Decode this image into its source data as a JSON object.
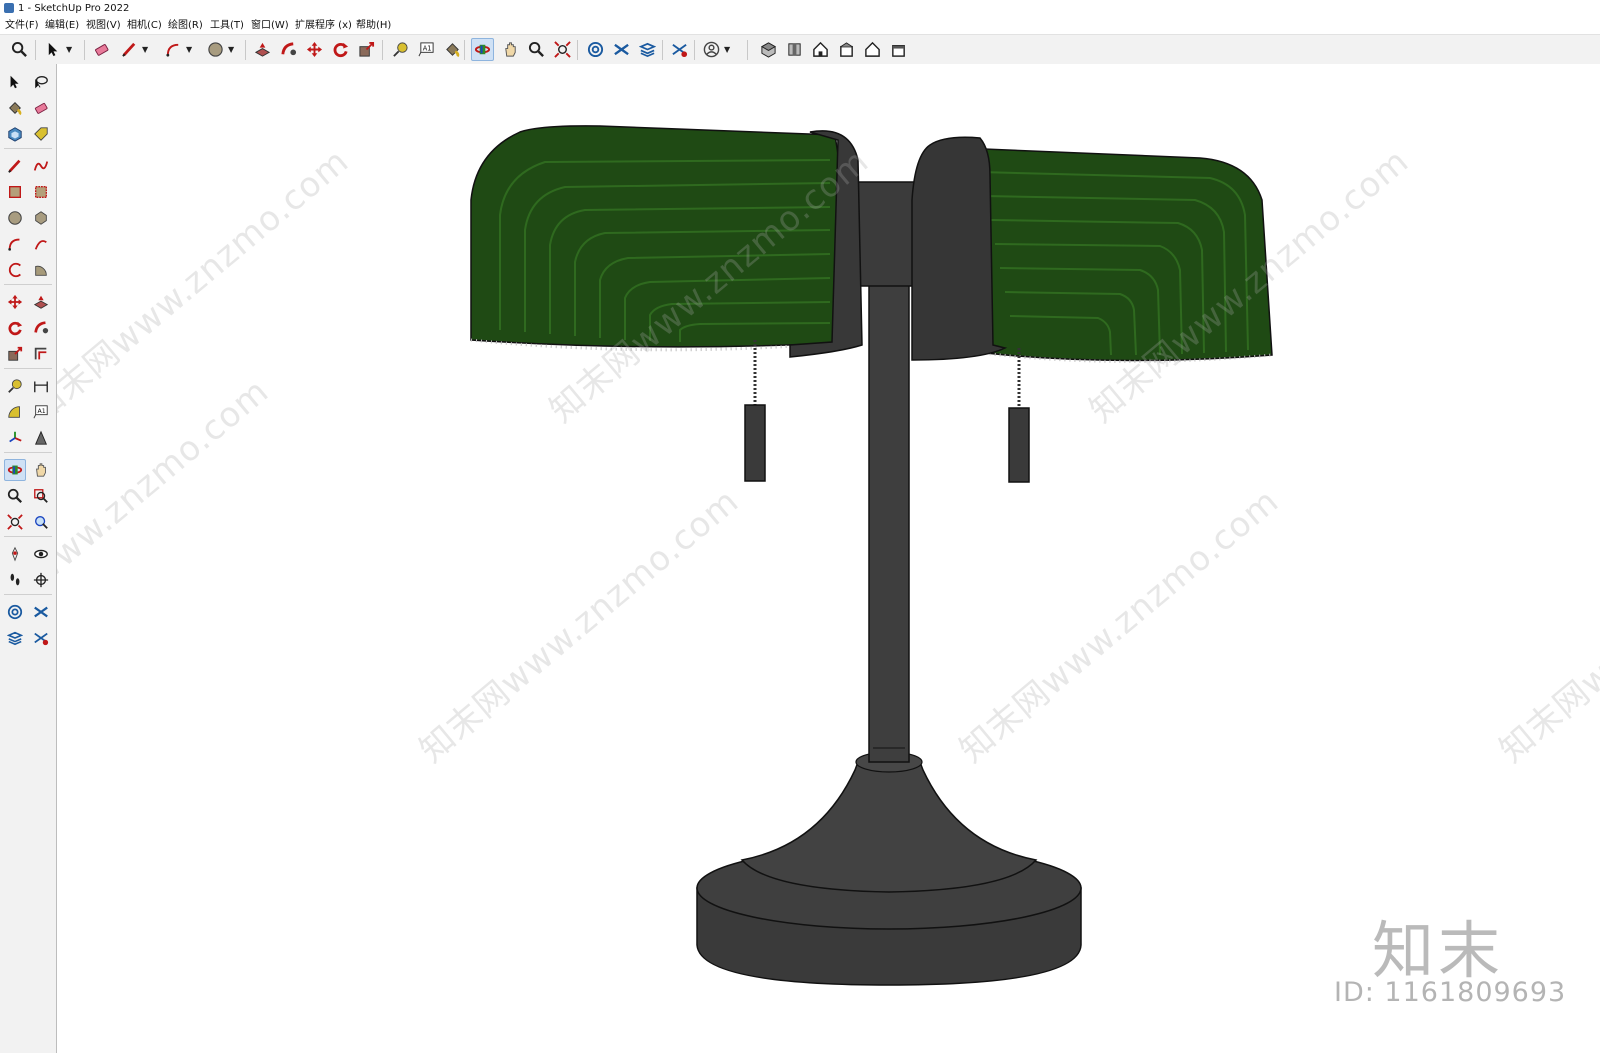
{
  "window": {
    "title": "1 - SketchUp Pro 2022"
  },
  "menu": [
    "文件(F)",
    "编辑(E)",
    "视图(V)",
    "相机(C)",
    "绘图(R)",
    "工具(T)",
    "窗口(W)",
    "扩展程序 (x)",
    "帮助(H)"
  ],
  "top_toolbar": [
    {
      "icon": "zoom-icon"
    },
    {
      "icon": "select-icon",
      "dropdown": true
    },
    {
      "icon": "eraser-icon"
    },
    {
      "icon": "pencil-line-icon",
      "dropdown": true
    },
    {
      "icon": "arc-icon",
      "dropdown": true
    },
    {
      "icon": "circle-icon",
      "dropdown": true
    },
    {
      "icon": "push-pull-icon"
    },
    {
      "icon": "follow-me-icon"
    },
    {
      "icon": "move-icon"
    },
    {
      "icon": "rotate-icon"
    },
    {
      "icon": "scale-icon"
    },
    {
      "icon": "tape-measure-icon"
    },
    {
      "icon": "text-icon"
    },
    {
      "icon": "paint-bucket-icon"
    },
    {
      "icon": "orbit-icon",
      "active": true
    },
    {
      "icon": "pan-icon"
    },
    {
      "icon": "zoom-icon"
    },
    {
      "icon": "zoom-extents-icon"
    },
    {
      "icon": "warehouse-icon"
    },
    {
      "icon": "extension-warehouse-icon"
    },
    {
      "icon": "layout-icon"
    },
    {
      "icon": "extension-manager-icon"
    },
    {
      "icon": "user-account-icon",
      "dropdown": true
    },
    {
      "icon": "iso-view-icon"
    },
    {
      "icon": "top-view-icon"
    },
    {
      "icon": "front-view-icon"
    },
    {
      "icon": "right-view-icon"
    },
    {
      "icon": "back-view-icon"
    },
    {
      "icon": "left-view-icon"
    }
  ],
  "left_toolbar": [
    {
      "icon": "select-icon"
    },
    {
      "icon": "lasso-select-icon"
    },
    {
      "icon": "paint-bucket-icon"
    },
    {
      "icon": "eraser-icon"
    },
    {
      "icon": "make-component-icon"
    },
    {
      "icon": "tag-icon"
    },
    {
      "icon": "pencil-line-icon"
    },
    {
      "icon": "freehand-icon"
    },
    {
      "icon": "rectangle-icon"
    },
    {
      "icon": "rotated-rectangle-icon"
    },
    {
      "icon": "circle-icon"
    },
    {
      "icon": "polygon-icon"
    },
    {
      "icon": "arc-icon"
    },
    {
      "icon": "two-point-arc-icon"
    },
    {
      "icon": "three-point-arc-icon"
    },
    {
      "icon": "pie-icon"
    },
    {
      "icon": "move-icon"
    },
    {
      "icon": "push-pull-icon"
    },
    {
      "icon": "rotate-icon"
    },
    {
      "icon": "follow-me-icon"
    },
    {
      "icon": "scale-icon"
    },
    {
      "icon": "offset-icon"
    },
    {
      "icon": "tape-measure-icon"
    },
    {
      "icon": "dimension-icon"
    },
    {
      "icon": "protractor-icon"
    },
    {
      "icon": "text-icon"
    },
    {
      "icon": "axes-icon"
    },
    {
      "icon": "3d-text-icon"
    },
    {
      "icon": "orbit-icon",
      "active": true
    },
    {
      "icon": "pan-icon"
    },
    {
      "icon": "zoom-icon"
    },
    {
      "icon": "zoom-window-icon"
    },
    {
      "icon": "zoom-extents-icon"
    },
    {
      "icon": "previous-view-icon"
    },
    {
      "icon": "position-camera-icon"
    },
    {
      "icon": "look-around-icon"
    },
    {
      "icon": "walk-icon"
    },
    {
      "icon": "section-plane-icon"
    },
    {
      "icon": "warehouse-icon"
    },
    {
      "icon": "extension-warehouse-icon"
    },
    {
      "icon": "layout-icon"
    },
    {
      "icon": "extension-manager-icon"
    }
  ],
  "viewport": {
    "model": "desk-lamp",
    "colors": {
      "shade_green": "#1f4a14",
      "shade_green_light": "#2e6a1e",
      "metal_dark": "#3a3a3a",
      "metal_mid": "#4a4a4a",
      "edge": "#111111"
    },
    "watermark_text": "知末网www.znzmo.com",
    "brand_logo": "知末",
    "brand_id": "ID: 1161809693"
  }
}
